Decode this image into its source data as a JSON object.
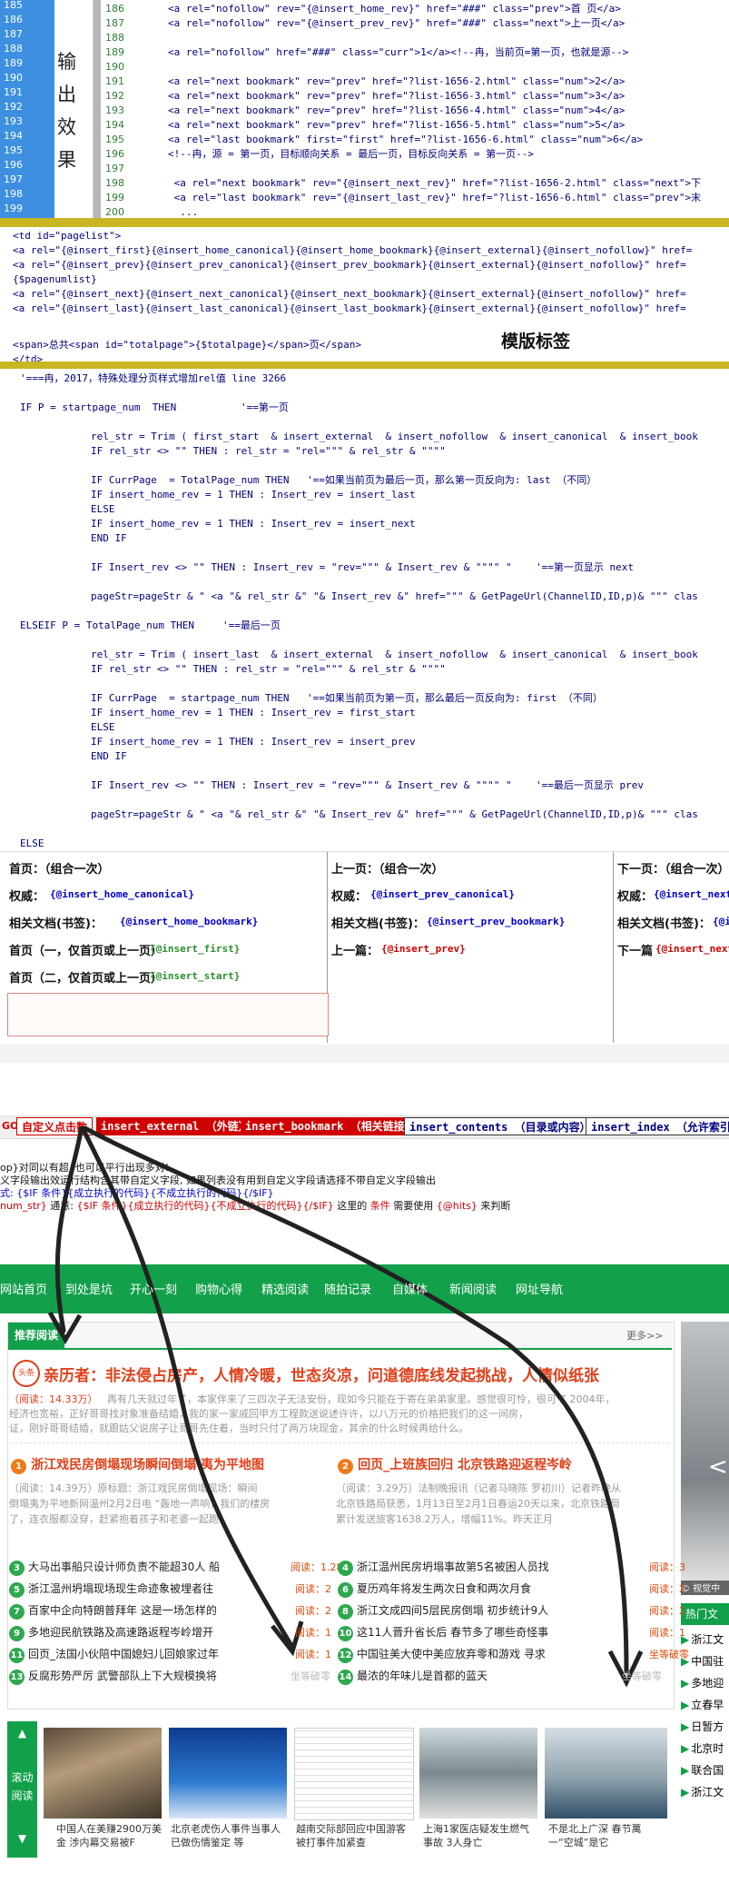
{
  "editor": {
    "line_numbers_a": [
      "185",
      "186",
      "187",
      "188",
      "189",
      "190",
      "191",
      "192",
      "193",
      "194",
      "195",
      "196",
      "197",
      "198",
      "199",
      "200"
    ],
    "side_label": [
      "输",
      "出",
      "效",
      "果"
    ],
    "line_numbers_b": [
      "186",
      "187",
      "188",
      "189",
      "190",
      "191",
      "192",
      "193",
      "194",
      "195",
      "196",
      "197",
      "198",
      "199",
      "200"
    ],
    "lines": [
      "<a rel=\"nofollow\" rev=\"{@insert_home_rev}\" href=\"###\" class=\"prev\">首 页</a>",
      "<a rel=\"nofollow\" rev=\"{@insert_prev_rev}\" href=\"###\" class=\"next\">上一页</a>",
      "",
      "<a rel=\"nofollow\" href=\"###\" class=\"curr\">1</a><!--冉，当前页=第一页，也就是源-->",
      "",
      "<a rel=\"next bookmark\" rev=\"prev\" href=\"?list-1656-2.html\" class=\"num\">2</a>",
      "<a rel=\"next bookmark\" rev=\"prev\" href=\"?list-1656-3.html\" class=\"num\">3</a>",
      "<a rel=\"next bookmark\" rev=\"prev\" href=\"?list-1656-4.html\" class=\"num\">4</a>",
      "<a rel=\"next bookmark\" rev=\"prev\" href=\"?list-1656-5.html\" class=\"num\">5</a>",
      "<a rel=\"last bookmark\" first=\"first\" href=\"?list-1656-6.html\" class=\"num\">6</a>",
      "<!--冉，源 = 第一页，目标顺向关系 = 最后一页，目标反向关系 = 第一页-->",
      "",
      " <a rel=\"next bookmark\" rev=\"{@insert_next_rev}\" href=\"?list-1656-2.html\" class=\"next\">下",
      " <a rel=\"last bookmark\" rev=\"{@insert_last_rev}\" href=\"?list-1656-6.html\" class=\"prev\">末",
      "  ..."
    ]
  },
  "template": {
    "lines": [
      "<td id=\"pagelist\">",
      "<a rel=\"{@insert_first}{@insert_home_canonical}{@insert_home_bookmark}{@insert_external}{@insert_nofollow}\" href=",
      "<a rel=\"{@insert_prev}{@insert_prev_canonical}{@insert_prev_bookmark}{@insert_external}{@insert_nofollow}\" href=",
      "{$pagenumlist}",
      "<a rel=\"{@insert_next}{@insert_next_canonical}{@insert_next_bookmark}{@insert_external}{@insert_nofollow}\" href=",
      "<a rel=\"{@insert_last}{@insert_last_canonical}{@insert_last_bookmark}{@insert_external}{@insert_nofollow}\" href=",
      "",
      "<span>总共<span id=\"totalpage\">{$totalpage}</span>页</span>",
      "</td>"
    ],
    "tag_label": "模版标签"
  },
  "vb": {
    "header": "'===冉，2017，特殊处理分页样式增加rel值 line 3266",
    "l01": "IF P = startpage_num  THEN",
    "l01c": "'==第一页",
    "l02": "rel_str = Trim ( first_start  & insert_external  & insert_nofollow  & insert_canonical  & insert_book",
    "l03": "IF rel_str <> \"\" THEN : rel_str = \"rel=\"\"\" & rel_str & \"\"\"\"",
    "l04": "IF CurrPage  = TotalPage_num THEN",
    "l04c": "'==如果当前页为最后一页，那么第一页反向为: last （不同）",
    "l05": "IF insert_home_rev = 1 THEN : Insert_rev = insert_last",
    "l06": "ELSE",
    "l07": "IF insert_home_rev = 1 THEN : Insert_rev = insert_next",
    "l08": "END IF",
    "l09": "IF Insert_rev <> \"\" THEN : Insert_rev = \"rev=\"\"\" & Insert_rev & \"\"\"\" \"",
    "l09c": "'==第一页显示 next",
    "l10": "pageStr=pageStr & \" <a \"& rel_str &\" \"& Insert_rev &\" href=\"\"\" & GetPageUrl(ChannelID,ID,p)& \"\"\" clas",
    "l11": "ELSEIF P = TotalPage_num THEN",
    "l11c": "'==最后一页",
    "l12": "rel_str = Trim ( insert_last  & insert_external  & insert_nofollow  & insert_canonical  & insert_book",
    "l13": "IF rel_str <> \"\" THEN : rel_str = \"rel=\"\"\" & rel_str & \"\"\"\"",
    "l14": "IF CurrPage  = startpage_num THEN",
    "l14c": "'==如果当前页为第一页，那么最后一页反向为: first （不同）",
    "l15": "IF insert_home_rev = 1 THEN : Insert_rev = first_start",
    "l16": "ELSE",
    "l17": "IF insert_home_rev = 1 THEN : Insert_rev = insert_prev",
    "l18": "END IF",
    "l19": "IF Insert_rev <> \"\" THEN : Insert_rev = \"rev=\"\"\" & Insert_rev & \"\"\"\" \"",
    "l19c": "'==最后一页显示 prev",
    "l20": "pageStr=pageStr & \" <a \"& rel_str &\" \"& Insert_rev &\" href=\"\"\" & GetPageUrl(ChannelID,ID,p)& \"\"\" clas",
    "l21": "ELSE"
  },
  "table": {
    "c1": {
      "h": "首页：（组合一次）",
      "r1l": "权威：",
      "r1v": "{@insert_home_canonical}",
      "r2l": "相关文档(书签)：",
      "r2v": "{@insert_home_bookmark}",
      "r3l": "首页（一，仅首页或上一页）",
      "r3v": "{@insert_first}",
      "r4l": "首页（二，仅首页或上一页）",
      "r4v": "{@insert_start}"
    },
    "c2": {
      "h": "上一页：（组合一次）",
      "r1l": "权威：",
      "r1v": "{@insert_prev_canonical}",
      "r2l": "相关文档(书签)：",
      "r2v": "{@insert_prev_bookmark}",
      "r3l": "上一篇：",
      "r3v": "{@insert_prev}"
    },
    "c3": {
      "h": "下一页：（组合一次）",
      "r1l": "权威：",
      "r1v": "{@insert_next",
      "r2l": "相关文档(书签)：",
      "r2v": "{@i",
      "r3l": "下一篇",
      "r3v": "{@insert_next"
    }
  },
  "tags": {
    "go": "GO",
    "custom": "自定义点击数",
    "b1": "insert_external （外链）",
    "b2": "insert_bookmark （相关链接）",
    "b3": "insert_contents （目录或内容）",
    "b4": "insert_index （允许索引）",
    "help1": "op}对同以有超, 也可以平行出现多对!",
    "help2": "义字段输出效运行结构含其带自定义字段, 如果列表没有用到自定义字段请选择不带自定义字段输出",
    "help3": "式: {$IF 条件}{成立执行的代码}{不成立执行的代码}{/$IF}",
    "help4a": "num_str}",
    "help4b": "通意:",
    "help4c": "{$IF 条件}{成立执行的代码}{不成立执行的代码}{/$IF}",
    "help4d": "这里的",
    "help4e": "条件",
    "help4f": "需要使用",
    "help4g": "{@hits}",
    "help4h": "来判断"
  },
  "site": {
    "nav": [
      "网站首页",
      "到处是坑",
      "开心一刻",
      "购物心得",
      "精选阅读",
      "随拍记录",
      "自媒体",
      "新闻阅读",
      "网址导航"
    ],
    "section": "推荐阅读",
    "more": "更多>>",
    "headline": "亲历者：非法侵占房产，人情冷暖，世态炎凉，问道德底线发起挑战，人情似纸张",
    "headline_read": "（阅读：14.33万）",
    "headline_sum1": "再有几天就过年了，本家伴来了三四次子无法安份，现如今只能在于寄在弟弟家里。感觉很可怜，很可气  2004年，",
    "headline_sum2": "经济也宽裕，正好哥哥找对象准备结婚，我的家一家戚回甲方工程款送说述许许，以八万元的价格把我们的这一间房，",
    "headline_sum3": "证，刚好哥哥结婚，就跟姑父说房子让哥哥先住着，当时只付了两万块现金，其余的什么时候再给什么。",
    "f1n": "1",
    "f1": "浙江戏民房倒塌现场瞬间倒塌 夷为平地图",
    "f1s1": "（阅读：14.39万）原标题：浙江戏民房倒塌现场：瞬间",
    "f1s2": "倒塌夷为平地新网温州2月2日电 “轰地一声响，我们的楼房",
    "f1s3": "了，连衣服都没穿，赶紧抱着孩子和老婆一起跑",
    "f2n": "2",
    "f2": "回页_上班族回归 北京铁路迎返程岑岭",
    "f2s1": "（阅读：3.29万）法制晚报讯（记者马晓陈 罗初川）记者昨晚从",
    "f2s2": "北京铁路局获悉，1月13日至2月1日春运20天以来，北京铁路局",
    "f2s3": "累计发送旅客1638.2万人，增幅11%。昨天正月",
    "list": [
      {
        "n": "3",
        "t": "大马出事船只设计师负责不能超30人 船",
        "c": "阅读：1.28万"
      },
      {
        "n": "4",
        "t": "浙江温州民房坍塌事故第5名被困人员找",
        "c": "阅读：3"
      },
      {
        "n": "5",
        "t": "浙江温州坍塌现场现生命迹象被埋者往",
        "c": "阅读：2"
      },
      {
        "n": "6",
        "t": "夏历鸡年将发生两次日食和两次月食",
        "c": "阅读：2"
      },
      {
        "n": "7",
        "t": "百家中企向特朗普拜年 这是一场怎样的",
        "c": "阅读：2"
      },
      {
        "n": "8",
        "t": "浙江文成四间5层民房倒塌 初步统计9人",
        "c": "阅读：2"
      },
      {
        "n": "9",
        "t": "多地迎民航铁路及高速路返程岑岭增开",
        "c": "阅读：1"
      },
      {
        "n": "10",
        "t": "这11人晋升省长后 春节多了哪些奇怪事",
        "c": "阅读：1"
      },
      {
        "n": "11",
        "t": "回页_法国小伙陪中国媳妇儿回娘家过年",
        "c": "阅读：1"
      },
      {
        "n": "12",
        "t": "中国驻美大使中美应放弃零和游戏 寻求",
        "c": "坐等破零"
      },
      {
        "n": "13",
        "t": "反腐形势严厉 武警部队上下大规模换将",
        "c": "坐等破零"
      },
      {
        "n": "14",
        "t": "最浓的年味儿是首都的蓝天",
        "c": "坐等破零"
      }
    ],
    "scroll_label": [
      "滚",
      "动",
      "阅",
      "读"
    ],
    "caps": [
      [
        "中国人在美赚2900万美",
        "金 涉内幕交易被F"
      ],
      [
        "北京老虎伤人事件当事人",
        "已做伤情鉴定 等"
      ],
      [
        "越南交际部回应中国游客",
        "被打事件加紧查"
      ],
      [
        "上海1家医店疑发生燃气",
        "事故 3人身亡"
      ],
      [
        "不是北上广深 春节萬",
        "一“空城”是它"
      ]
    ],
    "right": {
      "video": "© 视觉中",
      "hot": "热门文",
      "items": [
        "浙江文",
        "中国驻",
        "多地迎",
        "立春早",
        "日暂方",
        "北京时",
        "联合国",
        "浙江文"
      ]
    }
  },
  "colors": {
    "accent_green": "#12a04a",
    "headline_red": "#e0401a",
    "gold": "#c9b623"
  }
}
